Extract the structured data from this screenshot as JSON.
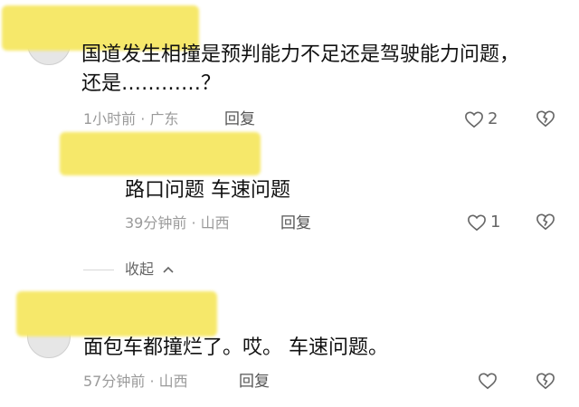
{
  "comments": [
    {
      "text_line1": "国道发生相撞是预判能力不足还是驾驶能力问题，",
      "text_line2": "还是…………？",
      "time": "1小时前",
      "location": "广东",
      "reply_label": "回复",
      "like_count": "2"
    },
    {
      "text": "路口问题 车速问题",
      "time": "39分钟前",
      "location": "山西",
      "reply_label": "回复",
      "like_count": "1"
    },
    {
      "text": "面包车都撞烂了。哎。 车速问题。",
      "time": "57分钟前",
      "location": "山西",
      "reply_label": "回复",
      "like_count": ""
    }
  ],
  "collapse": {
    "label": "收起"
  },
  "separator": "·",
  "colors": {
    "redaction_yellow": "#f6e86a",
    "meta_gray": "#9a9a9a"
  }
}
